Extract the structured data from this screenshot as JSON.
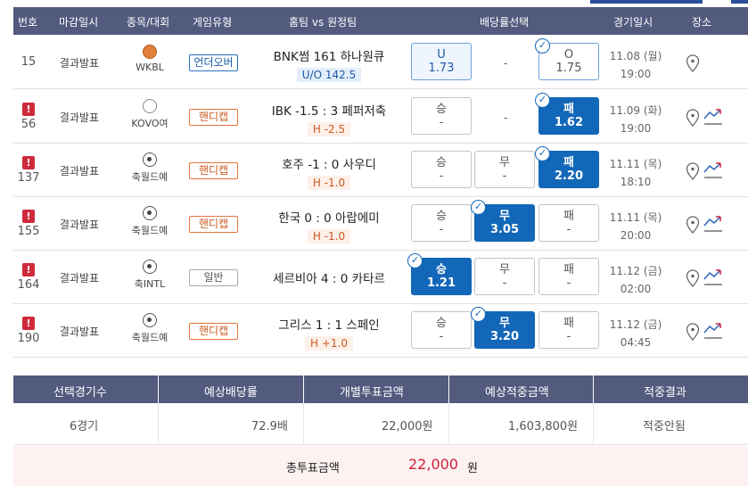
{
  "header": {
    "no": "번호",
    "deadline": "마감일시",
    "sport": "종목/대회",
    "game_type": "게임유형",
    "teams": "홈팀 vs 원정팀",
    "odds": "배당률선택",
    "datetime": "경기일시",
    "venue": "장소"
  },
  "rows": [
    {
      "no": "15",
      "deadline": "결과발표",
      "league": "WKBL",
      "sport_icon": "basketball-icon",
      "game_type": "언더오버",
      "teams": "BNK썸  161  하나원큐",
      "sub": "U/O 142.5",
      "b1_label": "U",
      "b1_odds": "1.73",
      "b2": "-",
      "b3_label": "O",
      "b3_odds": "1.75",
      "date": "11.08 (월)",
      "time": "19:00"
    },
    {
      "no": "56",
      "deadline": "결과발표",
      "league": "KOVO여",
      "sport_icon": "volleyball-icon",
      "game_type": "핸디캡",
      "teams": "IBK -1.5 : 3 페퍼저축",
      "sub": "H -2.5",
      "b1_label": "승",
      "b1_odds": "-",
      "b2": "-",
      "b3_label": "패",
      "b3_odds": "1.62",
      "date": "11.09 (화)",
      "time": "19:00"
    },
    {
      "no": "137",
      "deadline": "결과발표",
      "league": "축월드예",
      "sport_icon": "soccer-icon",
      "game_type": "핸디캡",
      "teams": "호주 -1 : 0 사우디",
      "sub": "H -1.0",
      "b1_label": "승",
      "b1_odds": "-",
      "b2_label": "무",
      "b2_odds": "-",
      "b3_label": "패",
      "b3_odds": "2.20",
      "date": "11.11 (목)",
      "time": "18:10"
    },
    {
      "no": "155",
      "deadline": "결과발표",
      "league": "축월드예",
      "sport_icon": "soccer-icon",
      "game_type": "핸디캡",
      "teams": "한국 0 : 0 아랍에미",
      "sub": "H -1.0",
      "b1_label": "승",
      "b1_odds": "-",
      "b2_label": "무",
      "b2_odds": "3.05",
      "b3_label": "패",
      "b3_odds": "-",
      "date": "11.11 (목)",
      "time": "20:00"
    },
    {
      "no": "164",
      "deadline": "결과발표",
      "league": "축INTL",
      "sport_icon": "soccer-icon",
      "game_type": "일반",
      "teams": "세르비아 4 : 0 카타르",
      "sub": "",
      "b1_label": "승",
      "b1_odds": "1.21",
      "b2_label": "무",
      "b2_odds": "-",
      "b3_label": "패",
      "b3_odds": "-",
      "date": "11.12 (금)",
      "time": "02:00"
    },
    {
      "no": "190",
      "deadline": "결과발표",
      "league": "축월드예",
      "sport_icon": "soccer-icon",
      "game_type": "핸디캡",
      "teams": "그리스 1 : 1 스페인",
      "sub": "H +1.0",
      "b1_label": "승",
      "b1_odds": "-",
      "b2_label": "무",
      "b2_odds": "3.20",
      "b3_label": "패",
      "b3_odds": "-",
      "date": "11.12 (금)",
      "time": "04:45"
    }
  ],
  "summary": {
    "h_count": "선택경기수",
    "h_odds": "예상배당률",
    "h_stake": "개별투표금액",
    "h_payout": "예상적중금액",
    "h_result": "적중결과",
    "count": "6경기",
    "odds": "72.9배",
    "stake": "22,000원",
    "payout": "1,603,800원",
    "result": "적중안됨",
    "total_label": "총투표금액",
    "total_value": "22,000",
    "total_unit": "원"
  },
  "colors": {
    "header_bg": "#525a7e",
    "selected_bg": "#1367b8",
    "alert_red": "#cf2a3c",
    "total_red": "#d0213a"
  }
}
